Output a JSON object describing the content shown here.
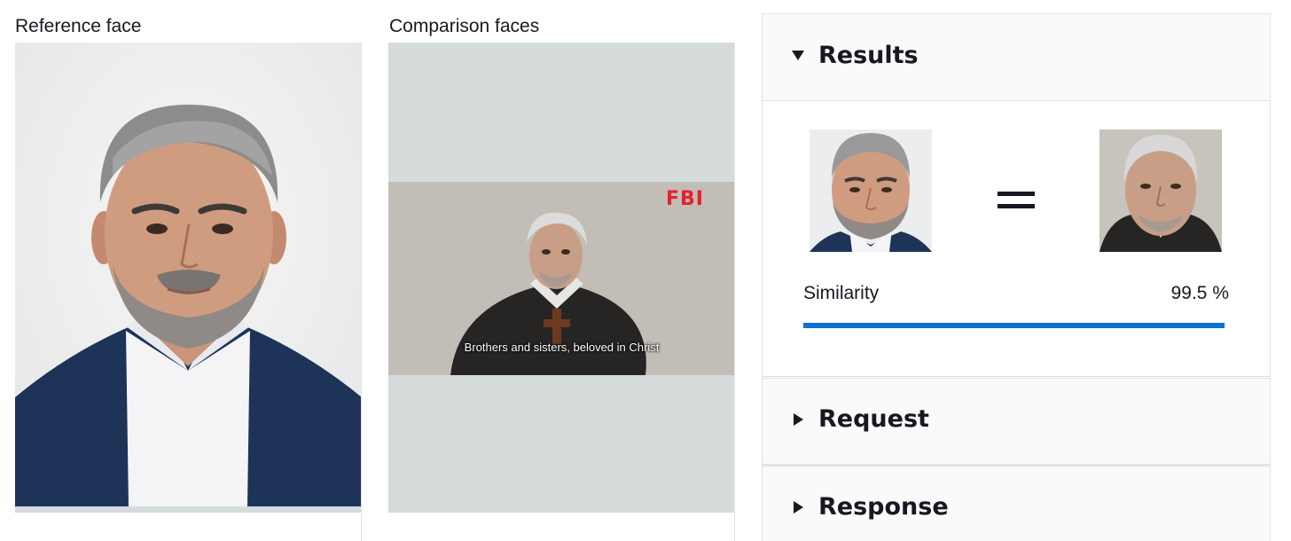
{
  "reference": {
    "label": "Reference face"
  },
  "comparison": {
    "label": "Comparison faces",
    "video_logo": "FBI",
    "subtitle": "Brothers and sisters, beloved in Christ"
  },
  "panel": {
    "results_title": "Results",
    "similarity_label": "Similarity",
    "similarity_value": "99.5 %",
    "similarity_fraction": 0.995,
    "request_title": "Request",
    "response_title": "Response"
  },
  "colors": {
    "progress_fill": "#0972d3",
    "logo_red": "#e8202e",
    "jacket_blue": "#1e3358"
  },
  "icons": {
    "results_toggle": "caret-down-icon",
    "request_toggle": "caret-right-icon",
    "response_toggle": "caret-right-icon",
    "match": "equals-icon"
  }
}
